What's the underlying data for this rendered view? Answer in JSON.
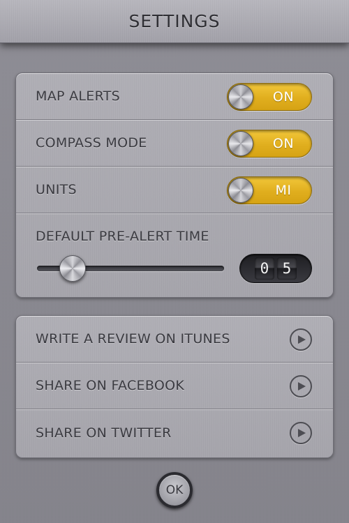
{
  "header": {
    "title": "SETTINGS"
  },
  "settings": {
    "map_alerts": {
      "label": "MAP ALERTS",
      "state": "ON"
    },
    "compass_mode": {
      "label": "COMPASS MODE",
      "state": "ON"
    },
    "units": {
      "label": "UNITS",
      "state": "MI"
    },
    "pre_alert": {
      "label": "DEFAULT PRE-ALERT TIME",
      "digit1": "0",
      "digit2": "5"
    }
  },
  "links": {
    "review": {
      "label": "WRITE A REVIEW ON ITUNES",
      "icon": "play-circle-icon"
    },
    "facebook": {
      "label": "SHARE ON FACEBOOK",
      "icon": "play-circle-icon"
    },
    "twitter": {
      "label": "SHARE ON TWITTER",
      "icon": "play-circle-icon"
    }
  },
  "footer": {
    "ok_label": "OK"
  },
  "colors": {
    "accent": "#e0ae1e",
    "panel": "#aaa9b0",
    "background": "#8a8991"
  }
}
